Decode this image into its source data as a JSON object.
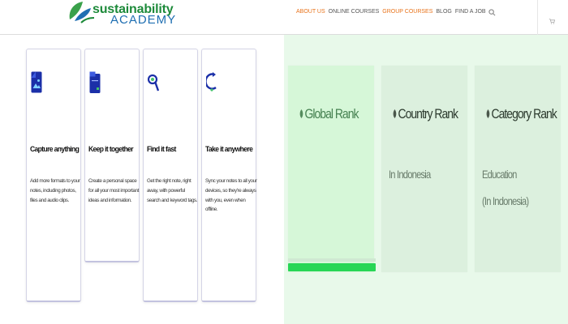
{
  "brand": {
    "name_line1": "sustainability",
    "name_line2": "ACADEMY",
    "colors": {
      "green": "#1d8a3a",
      "blue": "#1f6fb2",
      "accent": "#e8731b"
    }
  },
  "nav": {
    "items": [
      {
        "label": "ABOUT US",
        "active": true
      },
      {
        "label": "ONLINE COURSES",
        "active": false
      },
      {
        "label": "GROUP COURSES",
        "active": true
      },
      {
        "label": "BLOG",
        "active": false
      },
      {
        "label": "FIND A JOB",
        "active": false
      }
    ],
    "search_icon": "search-icon",
    "cart_icon": "cart-icon"
  },
  "features": [
    {
      "icon": "document-image-icon",
      "title": "Capture anything",
      "description": "Add more formats to your notes, including photos, files and audio clips."
    },
    {
      "icon": "notebook-icon",
      "title": "Keep it together",
      "description": "Create a personal space for all your most important ideas and information."
    },
    {
      "icon": "search-icon",
      "title": "Find it fast",
      "description": "Get the right note, right away, with powerful search and keyword tags."
    },
    {
      "icon": "sync-icon",
      "title": "Take it anywhere",
      "description": "Sync your notes to all your devices, so they're always with you, even when offline."
    }
  ],
  "ranks": {
    "cards": [
      {
        "title": "Global Rank",
        "sub": []
      },
      {
        "title": "Country Rank",
        "sub": [
          "In Indonesia"
        ]
      },
      {
        "title": "Category Rank",
        "sub": [
          "Education",
          "(In Indonesia)"
        ]
      }
    ],
    "progress_fraction": 1.0,
    "accent": "#27d655"
  }
}
